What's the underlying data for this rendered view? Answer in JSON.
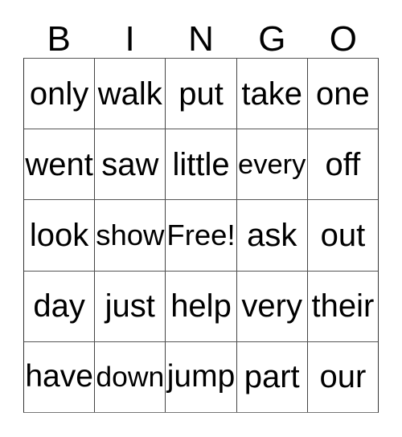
{
  "card": {
    "title": "BINGO",
    "headers": [
      "B",
      "I",
      "N",
      "G",
      "O"
    ],
    "free_space_label": "Free!",
    "free_space_position": {
      "row": 2,
      "col": 2
    },
    "grid_size": "5x5",
    "colors": {
      "background": "#ffffff",
      "text": "#000000",
      "grid_line": "#555555"
    },
    "rows": [
      {
        "cells": [
          {
            "text": "only",
            "free": false
          },
          {
            "text": "walk",
            "free": false
          },
          {
            "text": "put",
            "free": false
          },
          {
            "text": "take",
            "free": false
          },
          {
            "text": "one",
            "free": false
          }
        ]
      },
      {
        "cells": [
          {
            "text": "went",
            "free": false
          },
          {
            "text": "saw",
            "free": false
          },
          {
            "text": "little",
            "free": false
          },
          {
            "text": "every",
            "free": false
          },
          {
            "text": "off",
            "free": false
          }
        ]
      },
      {
        "cells": [
          {
            "text": "look",
            "free": false
          },
          {
            "text": "show",
            "free": false
          },
          {
            "text": "Free!",
            "free": true
          },
          {
            "text": "ask",
            "free": false
          },
          {
            "text": "out",
            "free": false
          }
        ]
      },
      {
        "cells": [
          {
            "text": "day",
            "free": false
          },
          {
            "text": "just",
            "free": false
          },
          {
            "text": "help",
            "free": false
          },
          {
            "text": "very",
            "free": false
          },
          {
            "text": "their",
            "free": false
          }
        ]
      },
      {
        "cells": [
          {
            "text": "have",
            "free": false
          },
          {
            "text": "down",
            "free": false
          },
          {
            "text": "jump",
            "free": false
          },
          {
            "text": "part",
            "free": false
          },
          {
            "text": "our",
            "free": false
          }
        ]
      }
    ]
  }
}
